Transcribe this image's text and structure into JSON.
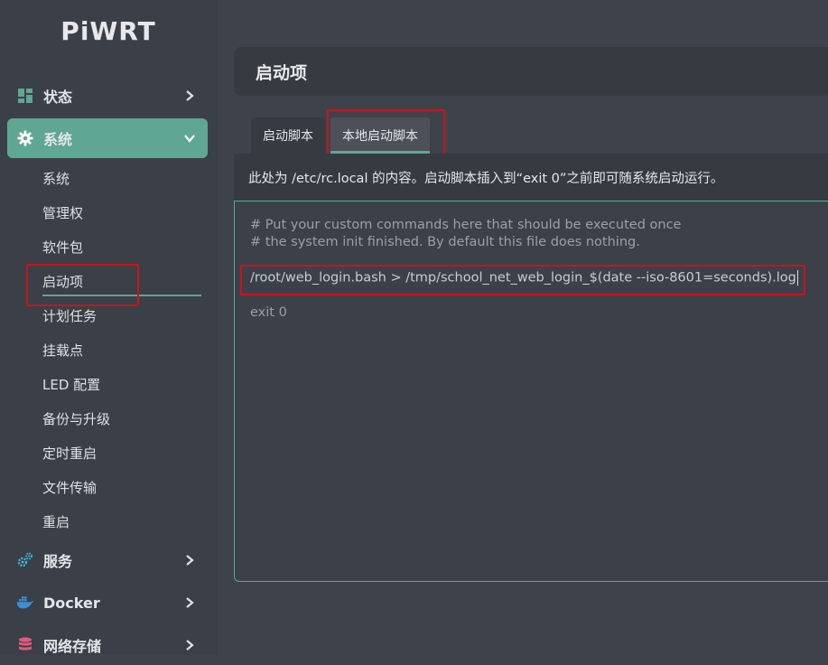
{
  "brand": "PiWRT",
  "nav": {
    "status": "状态",
    "system": "系统",
    "services": "服务",
    "docker": "Docker",
    "nas": "网络存储"
  },
  "system_submenu": [
    "系统",
    "管理权",
    "软件包",
    "启动项",
    "计划任务",
    "挂载点",
    "LED 配置",
    "备份与升级",
    "定时重启",
    "文件传输",
    "重启"
  ],
  "page_title": "启动项",
  "tabs": [
    "启动脚本",
    "本地启动脚本"
  ],
  "description": "此处为 /etc/rc.local 的内容。启动脚本插入到“exit 0”之前即可随系统启动运行。",
  "editor": {
    "lines": [
      "# Put your custom commands here that should be executed once",
      "# the system init finished. By default this file does nothing.",
      "/root/web_login.bash > /tmp/school_net_web_login_$(date --iso-8601=seconds).log",
      "exit 0"
    ]
  },
  "colors": {
    "accent": "#5fa693",
    "highlight_box": "#c8141e",
    "sidebar_bg": "#3b3f47",
    "page_bg": "#3e424a"
  }
}
